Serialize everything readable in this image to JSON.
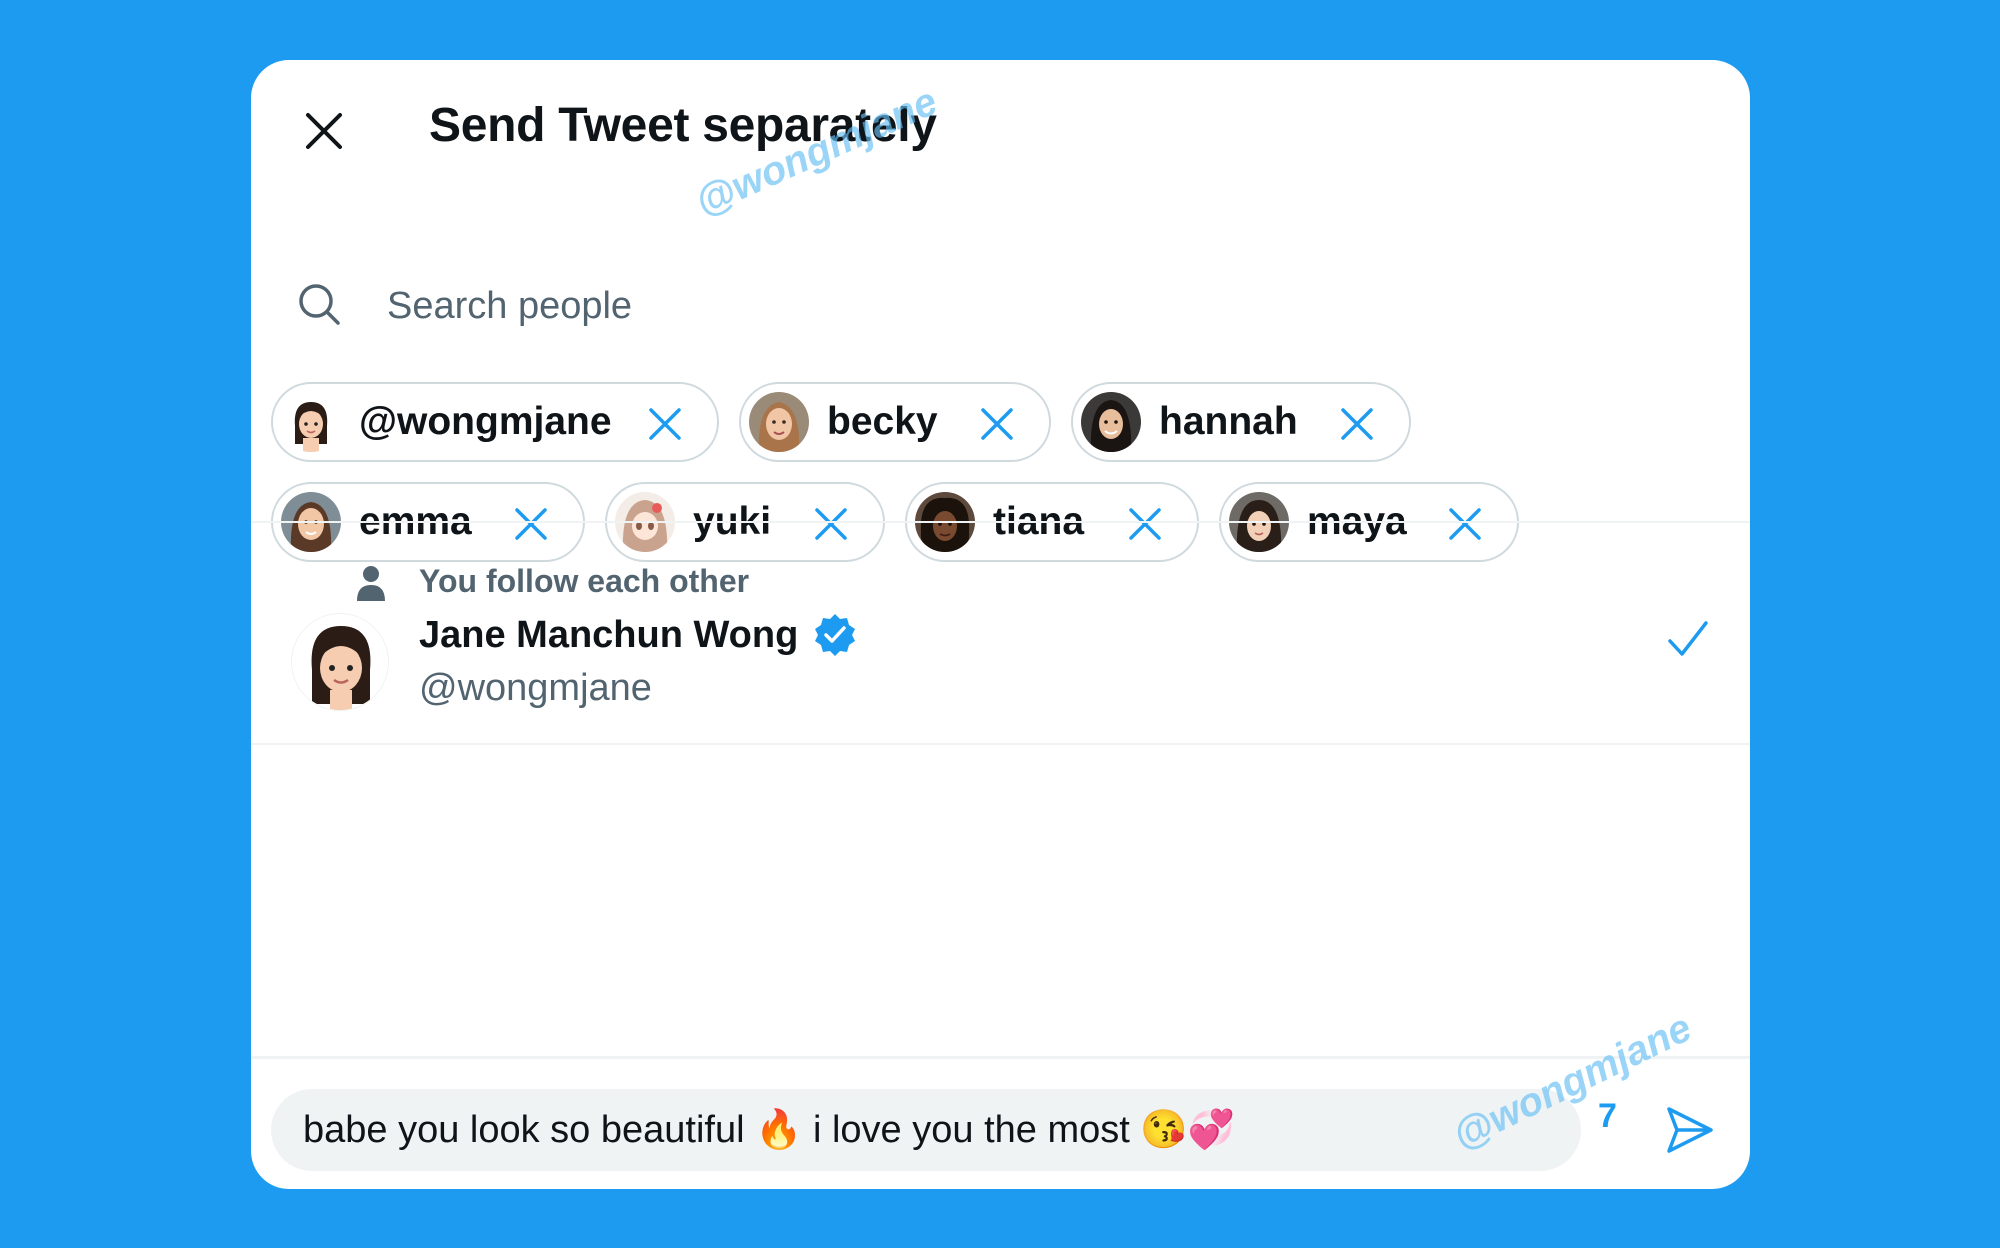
{
  "dialog": {
    "title": "Send Tweet separately",
    "close_icon": "close-icon"
  },
  "search": {
    "placeholder": "Search people",
    "value": ""
  },
  "selected_people": [
    {
      "label": "@wongmjane"
    },
    {
      "label": "becky"
    },
    {
      "label": "hannah"
    },
    {
      "label": "emma"
    },
    {
      "label": "yuki"
    },
    {
      "label": "tiana"
    },
    {
      "label": "maya"
    }
  ],
  "result": {
    "context": "You follow each other",
    "name": "Jane Manchun Wong",
    "handle": "@wongmjane",
    "verified": true,
    "selected": true
  },
  "composer": {
    "message": "babe you look so beautiful 🔥 i love you the most 😘💞",
    "count": "7"
  },
  "watermark": "@wongmjane",
  "colors": {
    "background": "#1d9bf0",
    "accent": "#1d9bf0",
    "text": "#0f1419",
    "secondary_text": "#536471",
    "border": "#cfd9de"
  }
}
